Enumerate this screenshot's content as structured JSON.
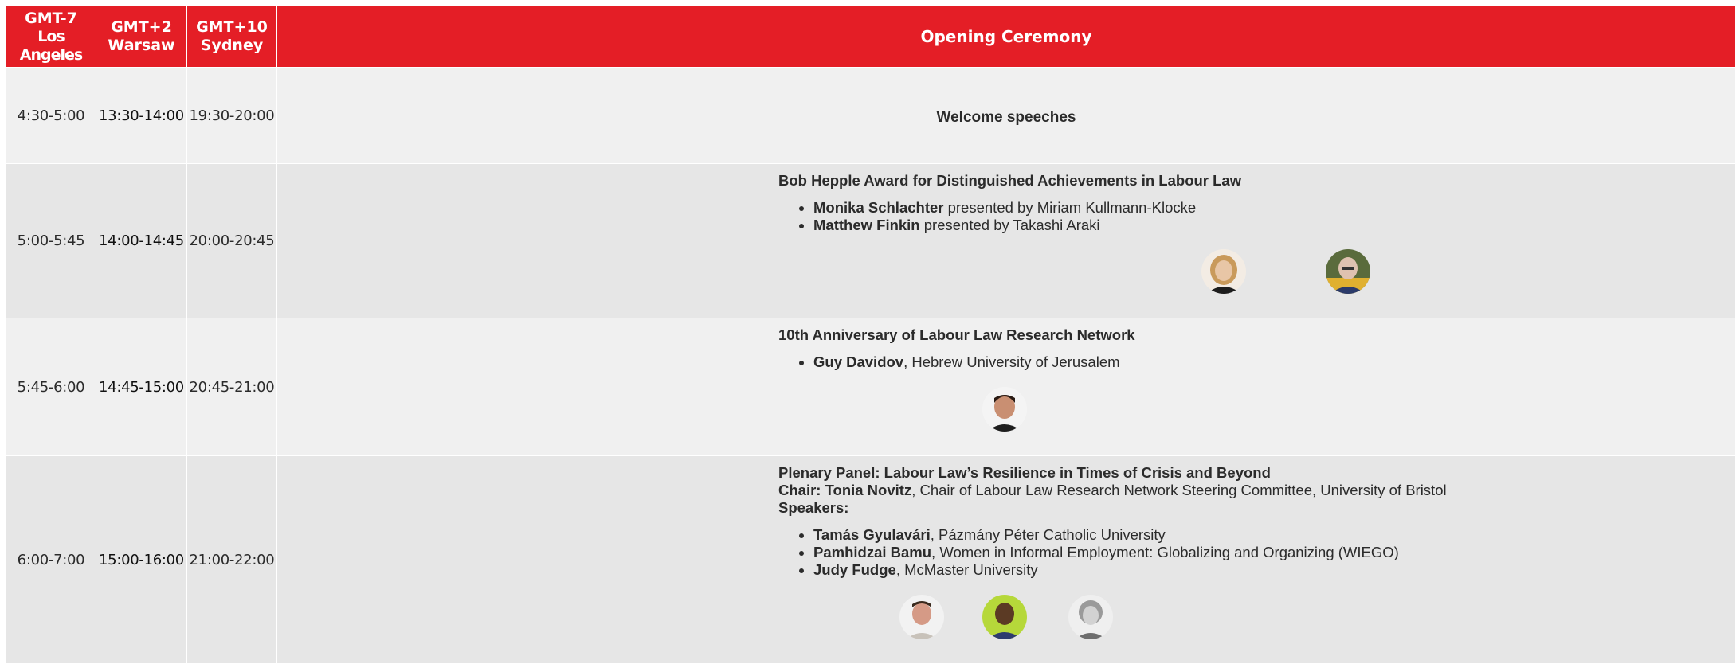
{
  "header": {
    "tz1_offset": "GMT-7",
    "tz1_city": "Los Angeles",
    "tz2_offset": "GMT+2",
    "tz2_city": "Warsaw",
    "tz3_offset": "GMT+10",
    "tz3_city": "Sydney",
    "title": "Opening Ceremony"
  },
  "rows": [
    {
      "la": "4:30-5:00",
      "waw": "13:30-14:00",
      "syd": "19:30-20:00",
      "title": "Welcome speeches"
    },
    {
      "la": "5:00-5:45",
      "waw": "14:00-14:45",
      "syd": "20:00-20:45",
      "title": "Bob Hepple Award for Distinguished Achievements in Labour Law",
      "items": [
        {
          "name": "Monika Schlachter",
          "rest": " presented by Miriam Kullmann-Klocke"
        },
        {
          "name": "Matthew Finkin",
          "rest": " presented by Takashi Araki"
        }
      ]
    },
    {
      "la": "5:45-6:00",
      "waw": "14:45-15:00",
      "syd": "20:45-21:00",
      "title": "10th Anniversary of Labour Law Research Network",
      "items": [
        {
          "name": "Guy Davidov",
          "rest": ", Hebrew University of Jerusalem"
        }
      ]
    },
    {
      "la": "6:00-7:00",
      "waw": "15:00-16:00",
      "syd": "21:00-22:00",
      "title": "Plenary Panel: Labour Law’s Resilience in Times of Crisis and Beyond",
      "chair_label": "Chair: Tonia Novitz",
      "chair_rest": ", Chair of Labour Law Research Network Steering Committee, University of Bristol",
      "speakers_label": "Speakers:",
      "items": [
        {
          "name": "Tamás Gyulavári",
          "rest": ", Pázmány Péter Catholic University"
        },
        {
          "name": "Pamhidzai Bamu",
          "rest": ", Women in Informal Employment: Globalizing and Organizing (WIEGO)"
        },
        {
          "name": "Judy Fudge",
          "rest": ", McMaster University"
        }
      ]
    }
  ],
  "colors": {
    "header_red": "#e41e26",
    "row_light": "#f0f0f0",
    "row_dark": "#e6e6e6"
  }
}
